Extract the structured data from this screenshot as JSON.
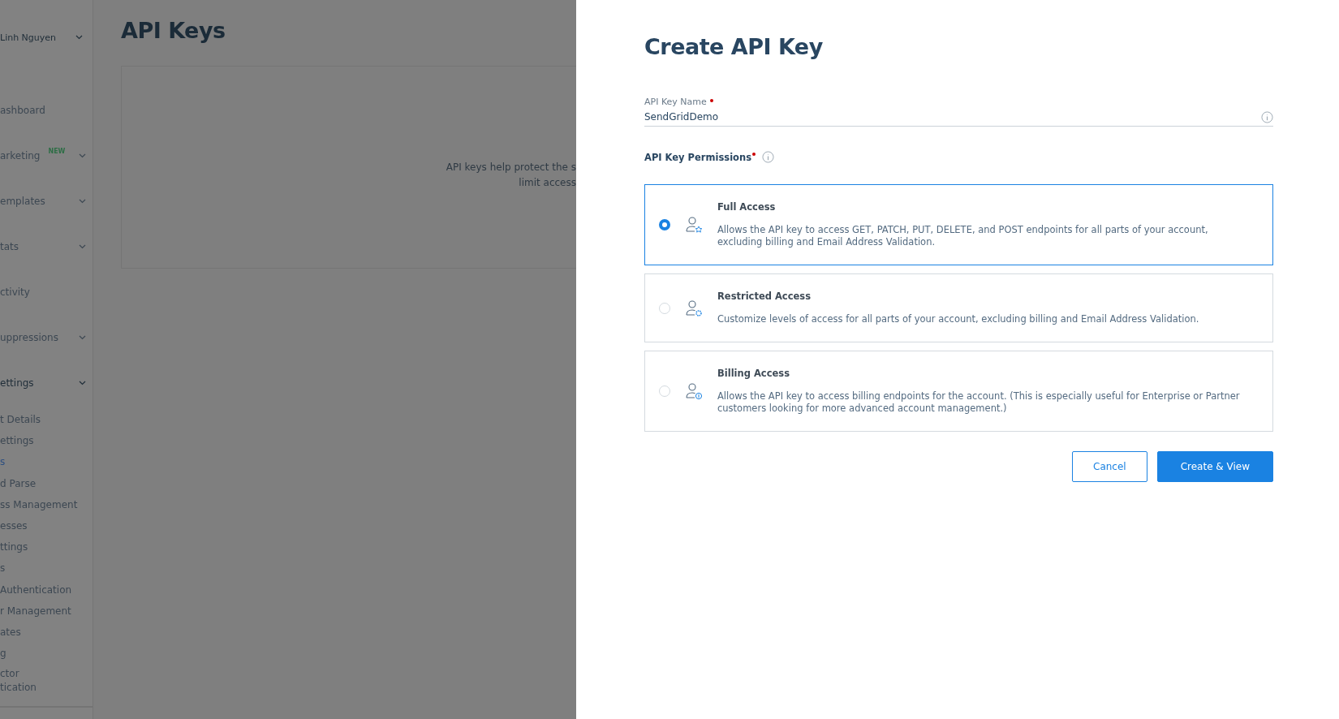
{
  "sidebar": {
    "user": {
      "name": "Linh Nguyen"
    },
    "items": [
      {
        "label": "ashboard",
        "expandable": false
      },
      {
        "label": "arketing",
        "badge": "NEW",
        "expandable": true
      },
      {
        "label": "emplates",
        "expandable": true
      },
      {
        "label": "tats",
        "expandable": true
      },
      {
        "label": "ctivity",
        "expandable": false
      },
      {
        "label": "uppressions",
        "expandable": true
      },
      {
        "label": "ettings",
        "expandable": true,
        "expanded": true
      }
    ],
    "sub_items": [
      {
        "label": "t Details",
        "selected": false
      },
      {
        "label": "ettings",
        "selected": false
      },
      {
        "label": "s",
        "selected": true
      },
      {
        "label": "d Parse",
        "selected": false
      },
      {
        "label": "ss Management",
        "selected": false
      },
      {
        "label": "esses",
        "selected": false
      },
      {
        "label": "ttings",
        "selected": false
      },
      {
        "label": "s",
        "selected": false
      },
      {
        "label": "Authentication",
        "selected": false
      },
      {
        "label": "r Management",
        "selected": false
      },
      {
        "label": "ates",
        "selected": false
      },
      {
        "label": "g",
        "selected": false
      },
      {
        "label": "ctor tication",
        "selected": false
      }
    ]
  },
  "page": {
    "title": "API Keys",
    "empty_text": [
      "API keys help protect the s",
      "limit access"
    ]
  },
  "dialog": {
    "title": "Create API Key",
    "name_field": {
      "label": "API Key Name",
      "required": true,
      "value": "SendGridDemo"
    },
    "permissions": {
      "label": "API Key Permissions",
      "required": true,
      "options": [
        {
          "kind": "full",
          "title": "Full Access",
          "description": "Allows the API key to access GET, PATCH, PUT, DELETE, and POST endpoints for all parts of your account, excluding billing and Email Address Validation.",
          "selected": true
        },
        {
          "kind": "restricted",
          "title": "Restricted Access",
          "description": "Customize levels of access for all parts of your account, excluding billing and Email Address Validation.",
          "selected": false
        },
        {
          "kind": "billing",
          "title": "Billing Access",
          "description": "Allows the API key to access billing endpoints for the account. (This is especially useful for Enterprise or Partner customers looking for more advanced account management.)",
          "selected": false
        }
      ]
    },
    "buttons": [
      {
        "label": "Cancel",
        "kind": "secondary"
      },
      {
        "label": "Create & View",
        "kind": "primary"
      }
    ]
  }
}
